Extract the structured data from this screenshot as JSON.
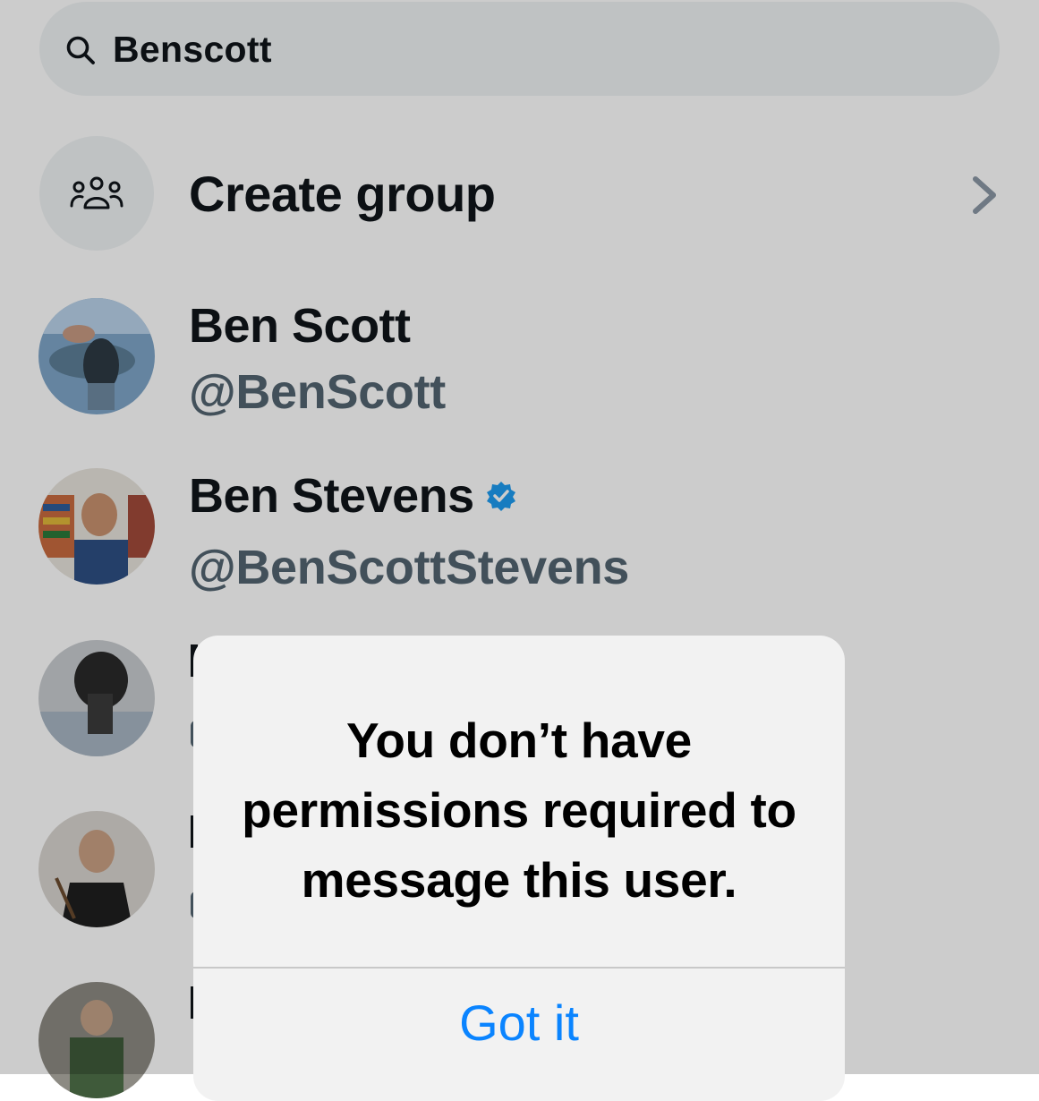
{
  "search": {
    "query": "Benscott",
    "icon": "search-icon"
  },
  "create_group": {
    "label": "Create group",
    "icon": "people-group-icon"
  },
  "users": [
    {
      "name": "Ben Scott",
      "handle": "@BenScott",
      "verified": false
    },
    {
      "name": "Ben Stevens",
      "handle": "@BenScottStevens",
      "verified": true
    }
  ],
  "alert": {
    "message": "You don’t have permissions required to message this user.",
    "button": "Got it"
  },
  "colors": {
    "accent": "#0a84ff",
    "verified": "#1d9bf0",
    "text": "#0f1419",
    "muted": "#536471"
  }
}
